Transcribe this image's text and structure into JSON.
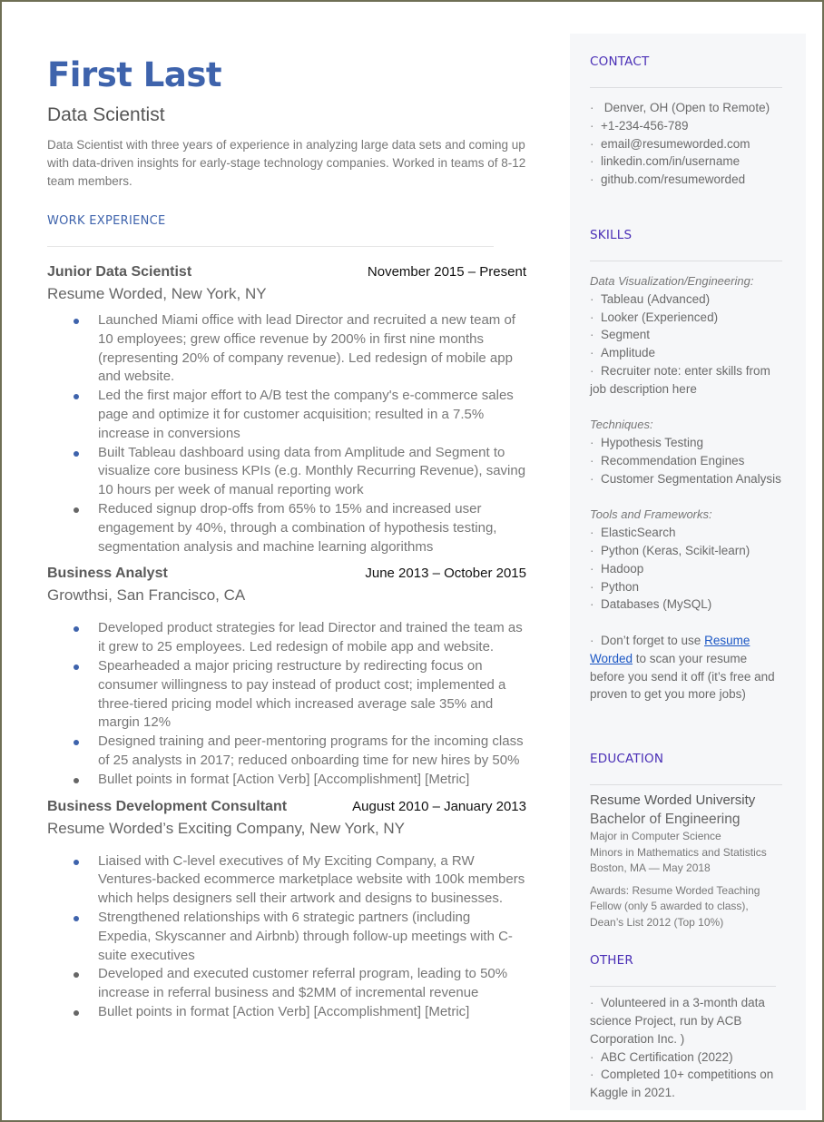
{
  "header": {
    "name": "First Last",
    "role": "Data Scientist",
    "summary": "Data Scientist with three years of experience in analyzing large data sets and coming up with data-driven insights for early-stage technology companies. Worked in teams of 8-12 team members."
  },
  "work": {
    "heading": "WORK EXPERIENCE",
    "jobs": [
      {
        "title": "Junior Data Scientist",
        "dates": "November 2015 – Present",
        "company": "Resume Worded, New York, NY",
        "bullets": [
          "Launched Miami office with lead Director and recruited a new team of 10 employees; grew office revenue by 200% in first nine months (representing 20% of company revenue). Led redesign of mobile app and website.",
          "Led the first major effort to A/B test the company's e-commerce sales page and optimize it for customer acquisition; resulted in a 7.5% increase in conversions",
          "Built Tableau dashboard using data from Amplitude and Segment to visualize core business KPIs (e.g. Monthly Recurring Revenue), saving 10 hours per week of manual reporting work",
          "Reduced signup drop-offs from 65% to 15% and increased user engagement by 40%, through a combination of hypothesis testing, segmentation analysis and machine learning algorithms"
        ]
      },
      {
        "title": "Business Analyst",
        "dates": "June 2013 – October 2015",
        "company": "Growthsi, San Francisco, CA",
        "bullets": [
          "Developed product strategies for lead Director and trained the team as it grew to 25 employees. Led redesign of mobile app and website.",
          "Spearheaded a major pricing restructure by redirecting focus on consumer willingness to pay instead of product cost; implemented a three-tiered pricing model which increased average sale 35% and margin 12%",
          "Designed training and peer-mentoring programs for the incoming class of 25 analysts in 2017; reduced onboarding time for new hires by 50%",
          "Bullet points in format [Action Verb] [Accomplishment] [Metric]"
        ]
      },
      {
        "title": "Business Development Consultant",
        "dates": "August 2010 – January 2013",
        "company": "Resume Worded’s Exciting Company, New York, NY",
        "bullets": [
          "Liaised with C-level executives of My Exciting Company, a RW Ventures-backed ecommerce marketplace website with 100k members which helps designers sell their artwork and designs to businesses.",
          "Strengthened relationships with 6 strategic partners (including Expedia, Skyscanner and Airbnb) through follow-up meetings with C-suite executives",
          "Developed and executed customer referral program, leading to 50% increase in referral business and $2MM of incremental revenue",
          "Bullet points in format [Action Verb] [Accomplishment] [Metric]"
        ]
      }
    ]
  },
  "sidebar": {
    "contact": {
      "heading": "CONTACT",
      "items": [
        " Denver, OH (Open to Remote)",
        "+1-234-456-789",
        "email@resumeworded.com",
        "linkedin.com/in/username",
        "github.com/resumeworded"
      ]
    },
    "skills": {
      "heading": "SKILLS",
      "group1_label": "Data Visualization/Engineering:",
      "group1": [
        "Tableau (Advanced)",
        "Looker (Experienced)",
        "Segment",
        "Amplitude",
        "Recruiter note: enter skills from job description here"
      ],
      "group2_label": "Techniques:",
      "group2": [
        "Hypothesis Testing",
        "Recommendation Engines",
        "Customer Segmentation Analysis"
      ],
      "group3_label": "Tools and Frameworks:",
      "group3": [
        "ElasticSearch",
        "Python (Keras, Scikit-learn)",
        "Hadoop",
        "Python",
        "Databases (MySQL)"
      ],
      "tip_before": "Don’t forget to use ",
      "tip_link": "Resume Worded",
      "tip_after": " to scan your resume before you send it off (it’s free and proven to get you more jobs)"
    },
    "education": {
      "heading": "EDUCATION",
      "school": "Resume Worded University",
      "degree": "Bachelor of Engineering",
      "major": "Major in Computer Science",
      "minors": "Minors in Mathematics and Statistics",
      "location_date": "Boston, MA — May 2018",
      "awards": "Awards: Resume Worded Teaching Fellow (only 5 awarded to class), Dean’s List 2012 (Top 10%)"
    },
    "other": {
      "heading": "OTHER",
      "items": [
        "Volunteered in a 3-month data science Project, run by ACB Corporation Inc. )",
        "ABC Certification (2022)",
        "Completed 10+ competitions on Kaggle in 2021."
      ]
    }
  },
  "colors": {
    "accent_blue": "#3e63ac",
    "sidebar_heading": "#4a2fb6",
    "sidebar_bg": "#f6f7f9",
    "link": "#1a56c4"
  }
}
